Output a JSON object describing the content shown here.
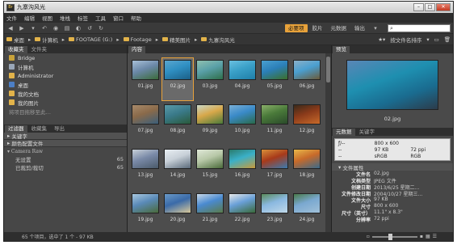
{
  "window": {
    "title": "九寨沟风光",
    "icon": "bridge-app-icon"
  },
  "menu": [
    "文件",
    "编辑",
    "视图",
    "堆栈",
    "标签",
    "工具",
    "窗口",
    "帮助"
  ],
  "workspaces": [
    {
      "label": "必要项",
      "active": true
    },
    {
      "label": "胶片",
      "active": false
    },
    {
      "label": "元数据",
      "active": false
    },
    {
      "label": "输出",
      "active": false
    }
  ],
  "search": {
    "placeholder": "",
    "value": ""
  },
  "path": [
    "桌面",
    "计算机",
    "FOOTAGE (G:)",
    "Footage",
    "精美图片",
    "九寨沟风光"
  ],
  "sort_label": "按文件名排序",
  "left": {
    "tabs": [
      "收藏夹",
      "文件夹"
    ],
    "favorites": [
      {
        "label": "Bridge",
        "icon": "bridge-icon",
        "color": "#c8a23a"
      },
      {
        "label": "计算机",
        "icon": "computer-icon",
        "color": "#9aa7b8"
      },
      {
        "label": "Administrator",
        "icon": "user-folder-icon",
        "color": "#e2b34a"
      },
      {
        "label": "桌面",
        "icon": "desktop-icon",
        "color": "#4c7fc6"
      },
      {
        "label": "我的文档",
        "icon": "documents-icon",
        "color": "#e2b34a"
      },
      {
        "label": "我的图片",
        "icon": "pictures-icon",
        "color": "#e2b34a"
      },
      {
        "label": "将项目拖移至此…",
        "icon": "",
        "color": ""
      }
    ],
    "filter_tabs": [
      "过滤器",
      "收藏集",
      "导出"
    ],
    "filter_groups": [
      {
        "label": "关键字"
      },
      {
        "label": "颜色配置文件"
      },
      {
        "label": "Camera Raw"
      }
    ],
    "filter_rows": [
      {
        "label": "无设置",
        "count": "65"
      },
      {
        "label": "已裁剪/裁切",
        "count": "65"
      }
    ]
  },
  "content": {
    "tab": "内容",
    "thumbs": [
      {
        "name": "01.jpg",
        "colors": [
          "#6b88a8",
          "#3b6b3a",
          "#a8c0d8"
        ]
      },
      {
        "name": "02.jpg",
        "colors": [
          "#2f8fc2",
          "#1b5f86",
          "#5aa6cf"
        ],
        "selected": true
      },
      {
        "name": "03.jpg",
        "colors": [
          "#5aa0a8",
          "#2f6f4a",
          "#8fc0b0"
        ]
      },
      {
        "name": "04.jpg",
        "colors": [
          "#3aa0c8",
          "#1f7fa8",
          "#6ac0e0"
        ]
      },
      {
        "name": "05.jpg",
        "colors": [
          "#2b7fb8",
          "#3b6f2a",
          "#4aa0d0"
        ]
      },
      {
        "name": "06.jpg",
        "colors": [
          "#4a9fd0",
          "#6a5a3a",
          "#8ab0c8"
        ]
      },
      {
        "name": "07.jpg",
        "colors": [
          "#8a6a4a",
          "#3b5f7a",
          "#a88a6a"
        ]
      },
      {
        "name": "08.jpg",
        "colors": [
          "#3a7a8a",
          "#2a5a3a",
          "#5a9aa8"
        ]
      },
      {
        "name": "09.jpg",
        "colors": [
          "#d8a84a",
          "#4a7a3a",
          "#c8d8c8"
        ]
      },
      {
        "name": "10.jpg",
        "colors": [
          "#3a8ac8",
          "#2a6a4a",
          "#7ab0d8"
        ]
      },
      {
        "name": "11.jpg",
        "colors": [
          "#4a7a3a",
          "#2a4a2a",
          "#8ab06a"
        ]
      },
      {
        "name": "12.jpg",
        "colors": [
          "#8a3a1a",
          "#c86a2a",
          "#3a2a1a"
        ]
      },
      {
        "name": "13.jpg",
        "colors": [
          "#7a8aa8",
          "#4a5a6a",
          "#c8d0d8"
        ]
      },
      {
        "name": "14.jpg",
        "colors": [
          "#c8d0d8",
          "#5a6a7a",
          "#e8eef2"
        ]
      },
      {
        "name": "15.jpg",
        "colors": [
          "#b8c8a8",
          "#4a6a3a",
          "#e0e8d8"
        ]
      },
      {
        "name": "16.jpg",
        "colors": [
          "#3ab0c8",
          "#c89a3a",
          "#2a7a6a"
        ]
      },
      {
        "name": "17.jpg",
        "colors": [
          "#a83a1a",
          "#3a7ab0",
          "#d8903a"
        ]
      },
      {
        "name": "18.jpg",
        "colors": [
          "#c86a2a",
          "#3a6a8a",
          "#e8b84a"
        ]
      },
      {
        "name": "19.jpg",
        "colors": [
          "#5a8ab8",
          "#4a6a3a",
          "#a8c8e0"
        ]
      },
      {
        "name": "20.jpg",
        "colors": [
          "#3a6aa8",
          "#d8c89a",
          "#6a9ac8"
        ]
      },
      {
        "name": "21.jpg",
        "colors": [
          "#4a8ad0",
          "#5a7a4a",
          "#c8d8e8"
        ]
      },
      {
        "name": "22.jpg",
        "colors": [
          "#6aa0d8",
          "#3a6a3a",
          "#e8e8e8"
        ]
      },
      {
        "name": "23.jpg",
        "colors": [
          "#8ab8e0",
          "#c0d8e8",
          "#5a8a5a"
        ]
      },
      {
        "name": "24.jpg",
        "colors": [
          "#7aa8d0",
          "#a0c0d8",
          "#4a7a4a"
        ]
      }
    ]
  },
  "preview": {
    "tab": "预览",
    "caption": "02.jpg"
  },
  "metadata": {
    "tabs": [
      "元数据",
      "关键字"
    ],
    "exif": [
      [
        "ƒ/--",
        "800 x 600",
        ""
      ],
      [
        "--",
        "97 KB",
        "72 ppi"
      ],
      [
        "--",
        "sRGB",
        "RGB"
      ]
    ],
    "section": "文件属性",
    "props": [
      {
        "k": "文件名",
        "v": "02.jpg"
      },
      {
        "k": "文档类型",
        "v": "JPEG 文件"
      },
      {
        "k": "创建日期",
        "v": "2013/6/25 星期二…"
      },
      {
        "k": "文件修改日期",
        "v": "2004/10/27 星期三…"
      },
      {
        "k": "文件大小",
        "v": "97 KB"
      },
      {
        "k": "尺寸",
        "v": "800 x 600"
      },
      {
        "k": "尺寸（英寸）",
        "v": "11.1\" x 8.3\""
      },
      {
        "k": "分辨率",
        "v": "72 ppi"
      }
    ]
  },
  "status": "65 个项目，选中了 1 个 - 97 KB"
}
